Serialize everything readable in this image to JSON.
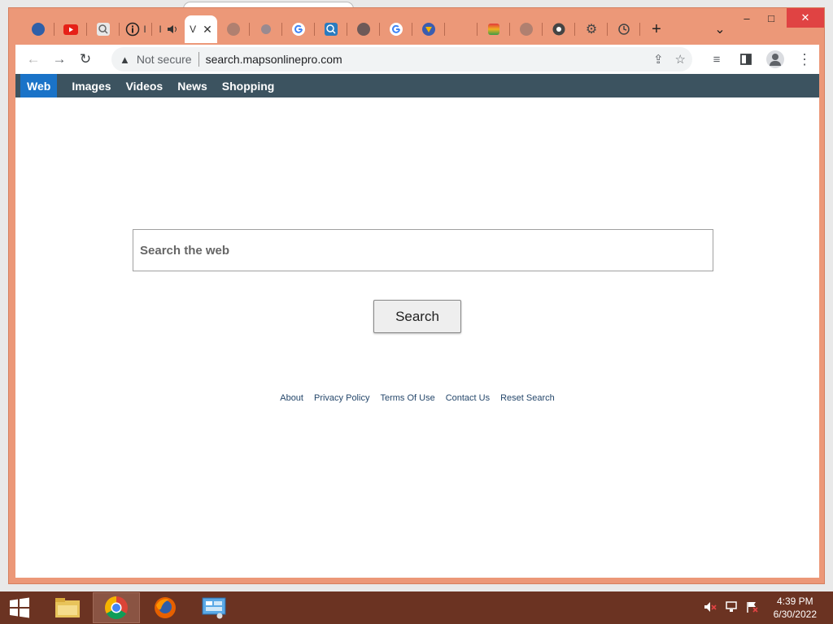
{
  "browser": {
    "active_tab_label": "V",
    "new_tab_symbol": "+",
    "tab_list_symbol": "⌄",
    "partial_tab_letters": [
      "I",
      "I"
    ],
    "window_controls": {
      "minimize": "–",
      "maximize": "□",
      "close": "✕"
    }
  },
  "address_bar": {
    "security_label": "Not secure",
    "url": "search.mapsonlinepro.com"
  },
  "site": {
    "nav": [
      "Web",
      "Images",
      "Videos",
      "News",
      "Shopping"
    ],
    "search_placeholder": "Search the web",
    "search_button": "Search",
    "footer_links": [
      "About",
      "Privacy Policy",
      "Terms Of Use",
      "Contact Us",
      "Reset Search"
    ]
  },
  "taskbar": {
    "time": "4:39 PM",
    "date": "6/30/2022"
  },
  "colors": {
    "window_frame": "#ec9878",
    "nav_bar": "#3c5360",
    "nav_active": "#1a73c8",
    "close_button": "#e04343",
    "taskbar": "#6b3322"
  }
}
